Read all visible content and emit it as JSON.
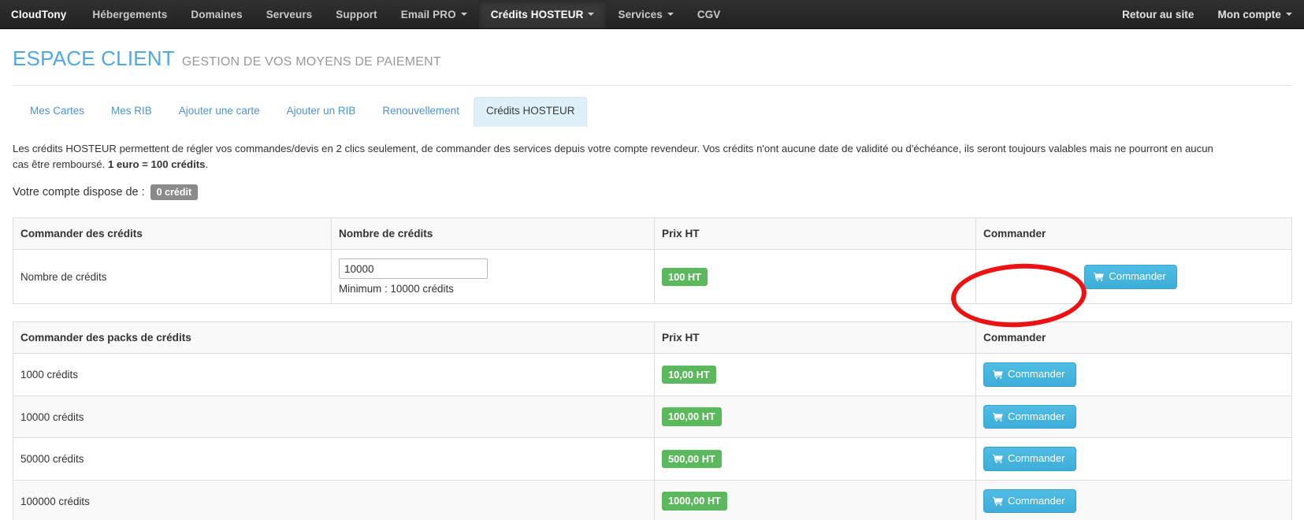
{
  "navbar": {
    "brand": "CloudTony",
    "left_items": [
      {
        "label": "Hébergements",
        "caret": false,
        "active": false
      },
      {
        "label": "Domaines",
        "caret": false,
        "active": false
      },
      {
        "label": "Serveurs",
        "caret": false,
        "active": false
      },
      {
        "label": "Support",
        "caret": false,
        "active": false
      },
      {
        "label": "Email PRO",
        "caret": true,
        "active": false
      },
      {
        "label": "Crédits HOSTEUR",
        "caret": true,
        "active": true
      },
      {
        "label": "Services",
        "caret": true,
        "active": false
      },
      {
        "label": "CGV",
        "caret": false,
        "active": false
      }
    ],
    "right_items": [
      {
        "label": "Retour au site",
        "caret": false
      },
      {
        "label": "Mon compte",
        "caret": true
      }
    ]
  },
  "header": {
    "title": "ESPACE CLIENT",
    "subtitle": "GESTION DE VOS MOYENS DE PAIEMENT"
  },
  "tabs": [
    {
      "label": "Mes Cartes",
      "active": false
    },
    {
      "label": "Mes RIB",
      "active": false
    },
    {
      "label": "Ajouter une carte",
      "active": false
    },
    {
      "label": "Ajouter un RIB",
      "active": false
    },
    {
      "label": "Renouvellement",
      "active": false
    },
    {
      "label": "Crédits HOSTEUR",
      "active": true
    }
  ],
  "intro": {
    "part1": "Les crédits HOSTEUR permettent de régler vos commandes/devis en 2 clics seulement, de commander des services depuis votre compte revendeur. Vos crédits n'ont aucune date de validité ou d'échéance, ils seront toujours valables mais ne pourront en aucun cas être remboursé. ",
    "bold": "1 euro = 100 crédits",
    "part2": "."
  },
  "balance": {
    "label": "Votre compte dispose de :",
    "value": "0 crédit"
  },
  "order_table": {
    "headers": [
      "Commander des crédits",
      "Nombre de crédits",
      "Prix HT",
      "Commander"
    ],
    "row": {
      "label": "Nombre de crédits",
      "input_value": "10000",
      "hint": "Minimum : 10000 crédits",
      "price": "100 HT",
      "button": "Commander"
    }
  },
  "packs_table": {
    "headers": [
      "Commander des packs de crédits",
      "Prix HT",
      "Commander"
    ],
    "rows": [
      {
        "name": "1000 crédits",
        "price": "10,00 HT",
        "button": "Commander"
      },
      {
        "name": "10000 crédits",
        "price": "100,00 HT",
        "button": "Commander"
      },
      {
        "name": "50000 crédits",
        "price": "500,00 HT",
        "button": "Commander"
      },
      {
        "name": "100000 crédits",
        "price": "1000,00 HT",
        "button": "Commander"
      }
    ]
  },
  "annotation": {
    "shape": "red-ellipse",
    "color": "#ee1111",
    "targets": "order-button-row-1"
  },
  "colors": {
    "brand_blue": "#4fa8e8",
    "button_blue": "#45b3dd",
    "badge_green": "#5cb85c",
    "badge_grey": "#8a8a8a",
    "navbar_dark": "#272727",
    "annotation_red": "#ee1111"
  },
  "icons": {
    "cart": "shopping-cart-icon",
    "caret": "chevron-down-icon"
  }
}
